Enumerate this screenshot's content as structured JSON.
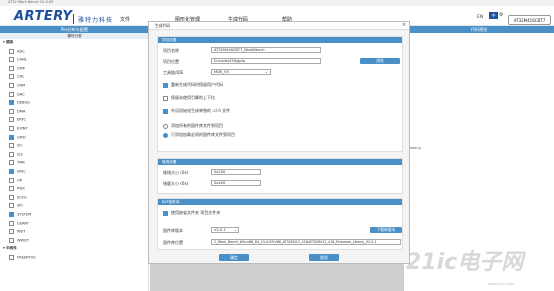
{
  "window": {
    "title": "AT32 Work Bench V1.0.05"
  },
  "header": {
    "logo": "ARTERY",
    "logo_cn": "雅特力科技",
    "menu": [
      "文件",
      "图形化管理",
      "生成代码",
      "帮助"
    ],
    "lang_en": "EN",
    "lang_cn": "中",
    "chip": "AT32M416CBT7"
  },
  "left_panel": {
    "tab": "Pin分布与配置",
    "subtab": "模块分类",
    "groups": [
      {
        "name": "模拟",
        "items": [
          {
            "label": "ADC",
            "checked": false
          },
          {
            "label": "CAN1",
            "checked": false
          },
          {
            "label": "CMP",
            "checked": false
          },
          {
            "label": "CRC",
            "checked": false
          },
          {
            "label": "CRM",
            "checked": false
          },
          {
            "label": "DAC",
            "checked": false
          },
          {
            "label": "DEBUG",
            "checked": true
          },
          {
            "label": "DMA",
            "checked": false
          },
          {
            "label": "ERTC",
            "checked": false
          },
          {
            "label": "EXINT",
            "checked": false
          },
          {
            "label": "GPIO",
            "checked": true
          },
          {
            "label": "I2C",
            "checked": false
          },
          {
            "label": "I2S",
            "checked": false
          },
          {
            "label": "TMR",
            "checked": false
          },
          {
            "label": "NVIC",
            "checked": true
          },
          {
            "label": "OP",
            "checked": false
          },
          {
            "label": "PWC",
            "checked": false
          },
          {
            "label": "SCFG",
            "checked": false
          },
          {
            "label": "SPI",
            "checked": false
          },
          {
            "label": "SYSTEM",
            "checked": true
          },
          {
            "label": "USART",
            "checked": false
          },
          {
            "label": "WDT",
            "checked": false
          },
          {
            "label": "WWDT",
            "checked": false
          }
        ]
      },
      {
        "name": "中间件",
        "items": [
          {
            "label": "FREERTOS",
            "checked": false
          }
        ]
      }
    ]
  },
  "right_panel": {
    "tab": "代码预览",
    "snippet": "_debug"
  },
  "dialog": {
    "title": "生成代码",
    "close": "×",
    "project": {
      "header": "项目设置",
      "name_label": "项目名称",
      "name_value": "AT32M416CBT7_WorkBench",
      "location_label": "项目位置",
      "location_value": "D:\\code\\416\\gpio",
      "browse_label": "浏览",
      "ide_label": "工具链/IDE",
      "ide_value": "MDK_V5",
      "options": [
        {
          "label": "重新生成代码时保留用户代码",
          "checked": true
        },
        {
          "label": "保留未使用引脚的上下拉",
          "checked": false
        },
        {
          "label": "外设初始化生成单独的 .c/.h 文件",
          "checked": true
        }
      ],
      "radios": [
        {
          "label": "添加所有的固件库文件到项目",
          "selected": false
        },
        {
          "label": "只添加加载必须的固件库文件到项目",
          "selected": true
        }
      ]
    },
    "stack": {
      "header": "堆栈设置",
      "heap_label": "堆栈大小 (0x)",
      "heap_value": "0x200",
      "stack_label": "栈量大小 (0x)",
      "stack_value": "0x400"
    },
    "firmware": {
      "header": "BSP固件库",
      "use_default_label": "使用缺省文件夹 项目文件夹",
      "use_default_checked": true,
      "version_label": "固件库版本",
      "version_value": "V2.0.1",
      "download_label": "下载新版本",
      "path_label": "固件库位置",
      "path_value": "2_Work_Bench_Win-x86_64_V1.0.05\\V86_AT32M412_416\\AT32M412_416_Firmware_Library_V2.0.1"
    },
    "ok_label": "确定",
    "cancel_label": "取消"
  },
  "colors": {
    "accent": "#4a90c8",
    "brand": "#1b4f9c",
    "overlay": "#cfcfcf"
  },
  "watermark": {
    "text": "21ic电子网",
    "sub": "www.21ic.com"
  }
}
